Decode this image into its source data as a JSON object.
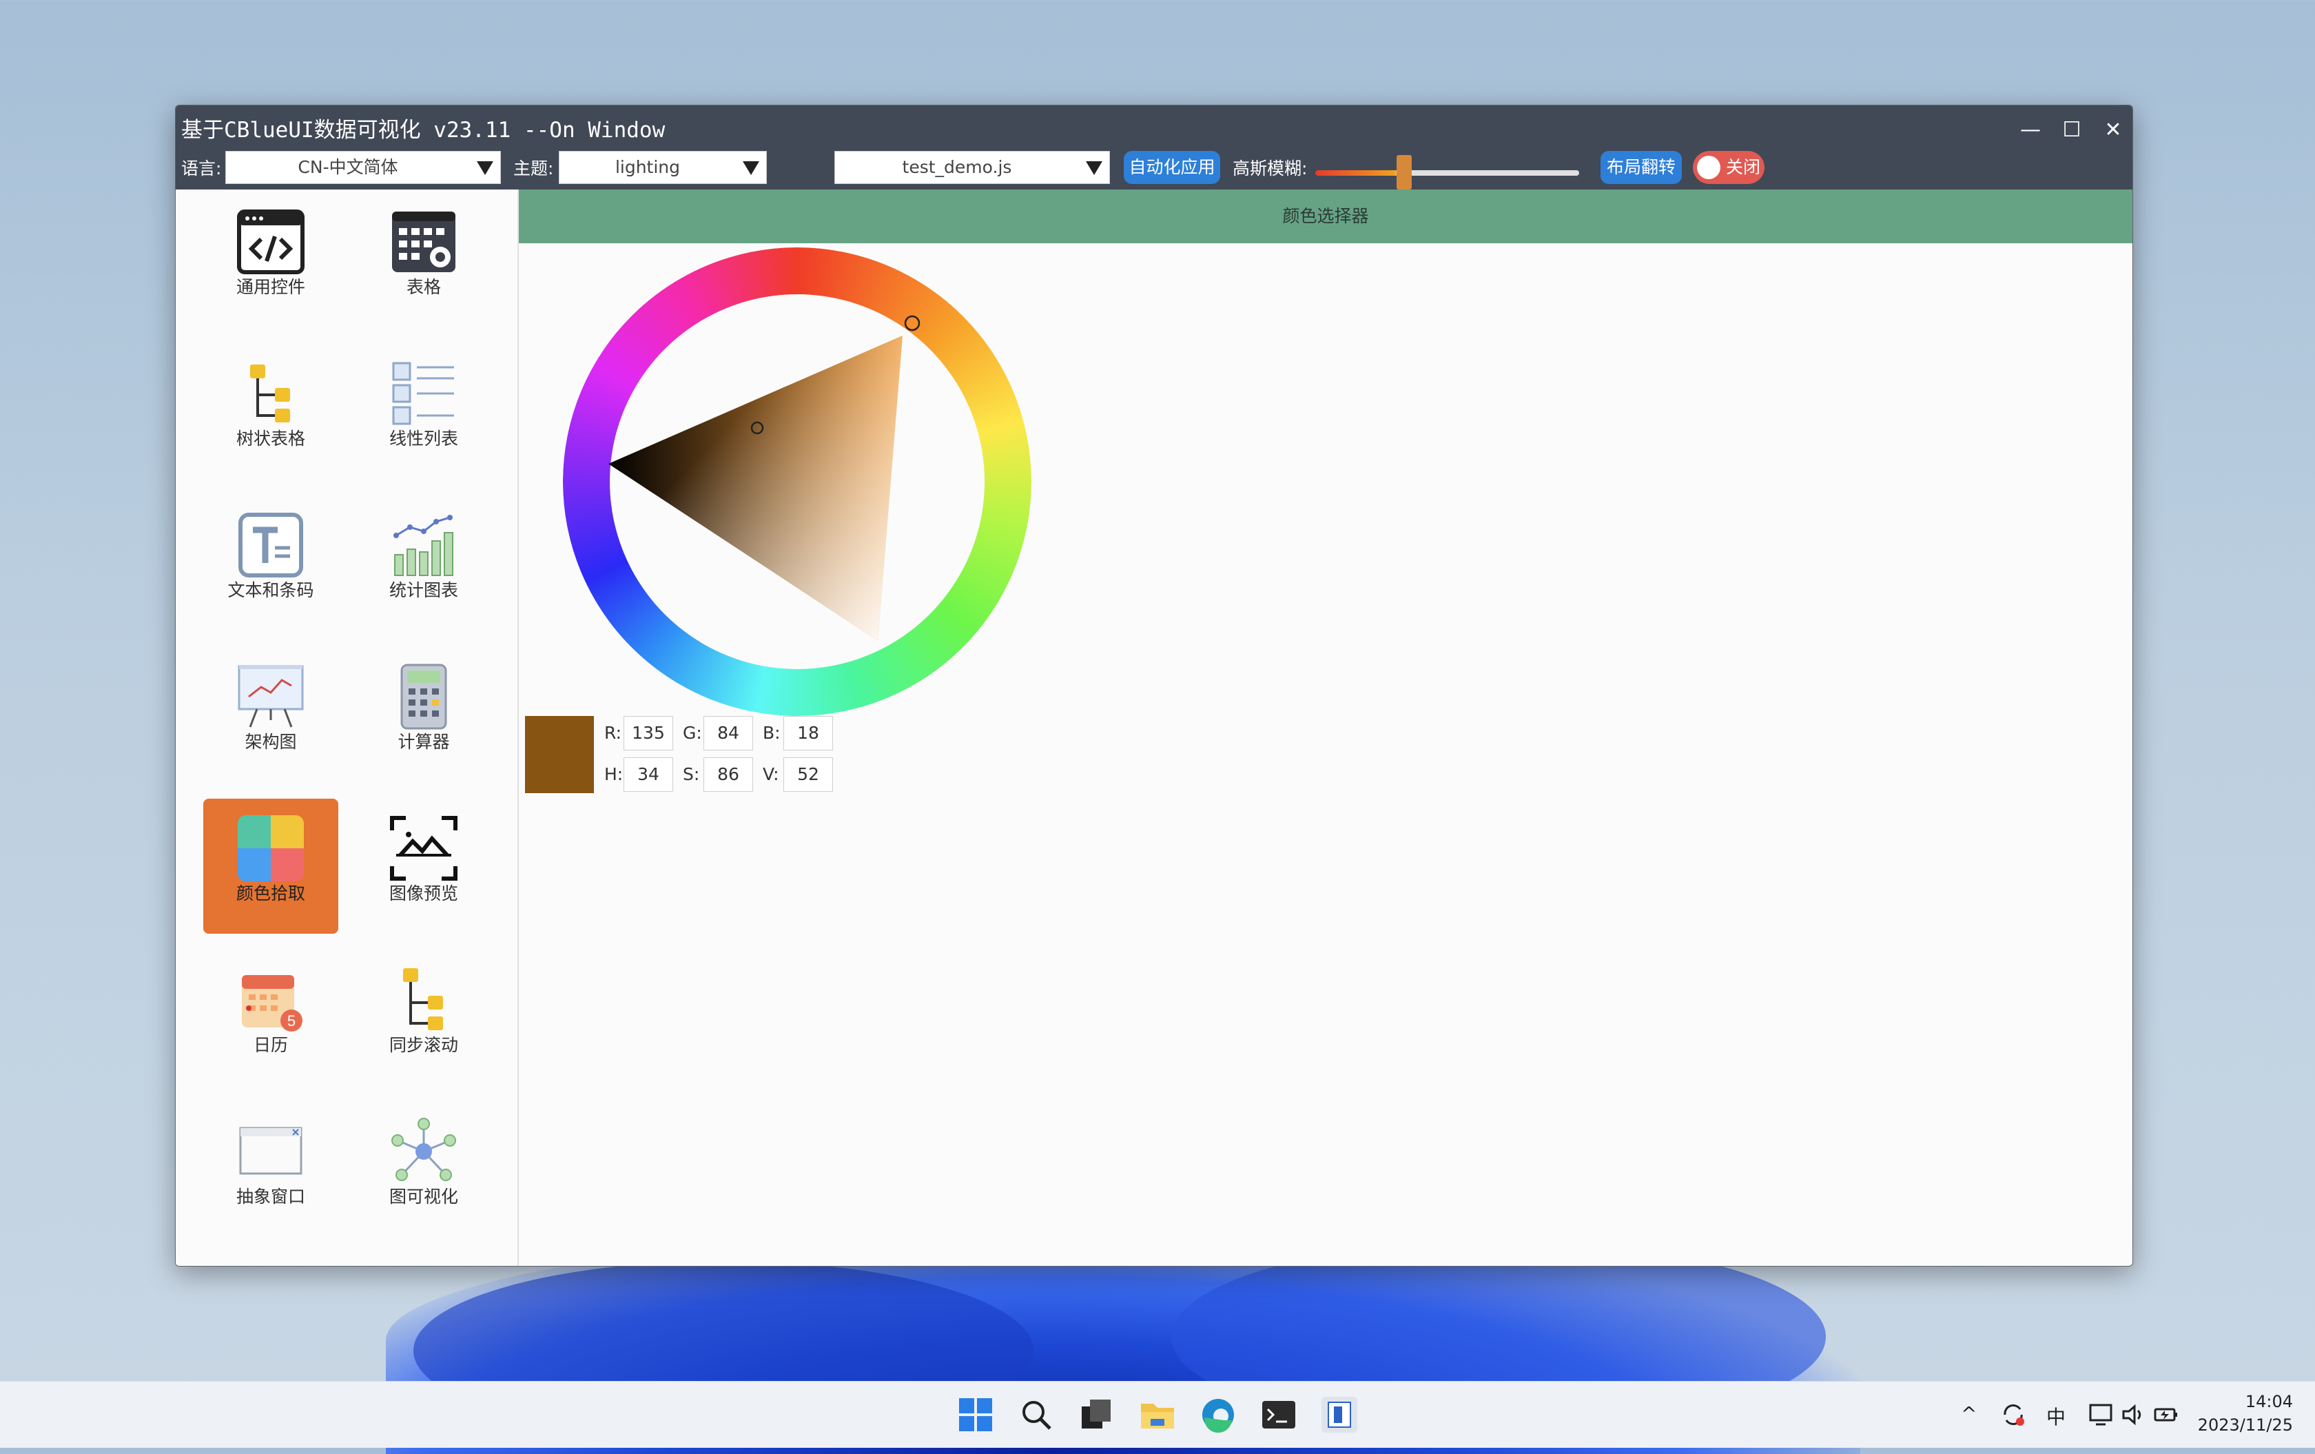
{
  "window": {
    "title": "基于CBlueUI数据可视化 v23.11 --On Window",
    "minimize_glyph": "—",
    "maximize_glyph": "☐",
    "close_glyph": "✕"
  },
  "toolbar": {
    "language_label": "语言:",
    "language_value": "CN-中文简体",
    "theme_label": "主题:",
    "theme_value": "lighting",
    "script_value": "test_demo.js",
    "auto_apply_label": "自动化应用",
    "blur_label": "高斯模糊:",
    "blur_level": 0.33,
    "layout_flip_label": "布局翻转",
    "toggle_label": "关闭",
    "toggle_on": false
  },
  "sidebar": {
    "items": [
      {
        "label": "通用控件",
        "icon": "code-window-icon"
      },
      {
        "label": "表格",
        "icon": "table-settings-icon"
      },
      {
        "label": "树状表格",
        "icon": "tree-table-icon"
      },
      {
        "label": "线性列表",
        "icon": "linear-list-icon"
      },
      {
        "label": "文本和条码",
        "icon": "text-barcode-icon"
      },
      {
        "label": "统计图表",
        "icon": "statistics-chart-icon"
      },
      {
        "label": "架构图",
        "icon": "architecture-board-icon"
      },
      {
        "label": "计算器",
        "icon": "calculator-icon"
      },
      {
        "label": "颜色拾取",
        "icon": "color-picker-icon",
        "active": true
      },
      {
        "label": "图像预览",
        "icon": "image-preview-icon"
      },
      {
        "label": "日历",
        "icon": "calendar-icon"
      },
      {
        "label": "同步滚动",
        "icon": "sync-scroll-icon"
      },
      {
        "label": "抽象窗口",
        "icon": "abstract-window-icon"
      },
      {
        "label": "图可视化",
        "icon": "graph-visualization-icon"
      }
    ]
  },
  "panel": {
    "header": "颜色选择器"
  },
  "color": {
    "swatch_hex": "#875412",
    "r_label": "R:",
    "r": "135",
    "g_label": "G:",
    "g": "84",
    "b_label": "B:",
    "b": "18",
    "h_label": "H:",
    "h": "34",
    "s_label": "S:",
    "s": "86",
    "v_label": "V:",
    "v": "52"
  },
  "taskbar": {
    "apps": [
      "start-icon",
      "search-icon",
      "task-view-icon",
      "file-explorer-icon",
      "edge-browser-icon",
      "terminal-icon",
      "app-window-icon"
    ],
    "tray_chevron": "^",
    "ime": "中",
    "time": "14:04",
    "date": "2023/11/25"
  }
}
